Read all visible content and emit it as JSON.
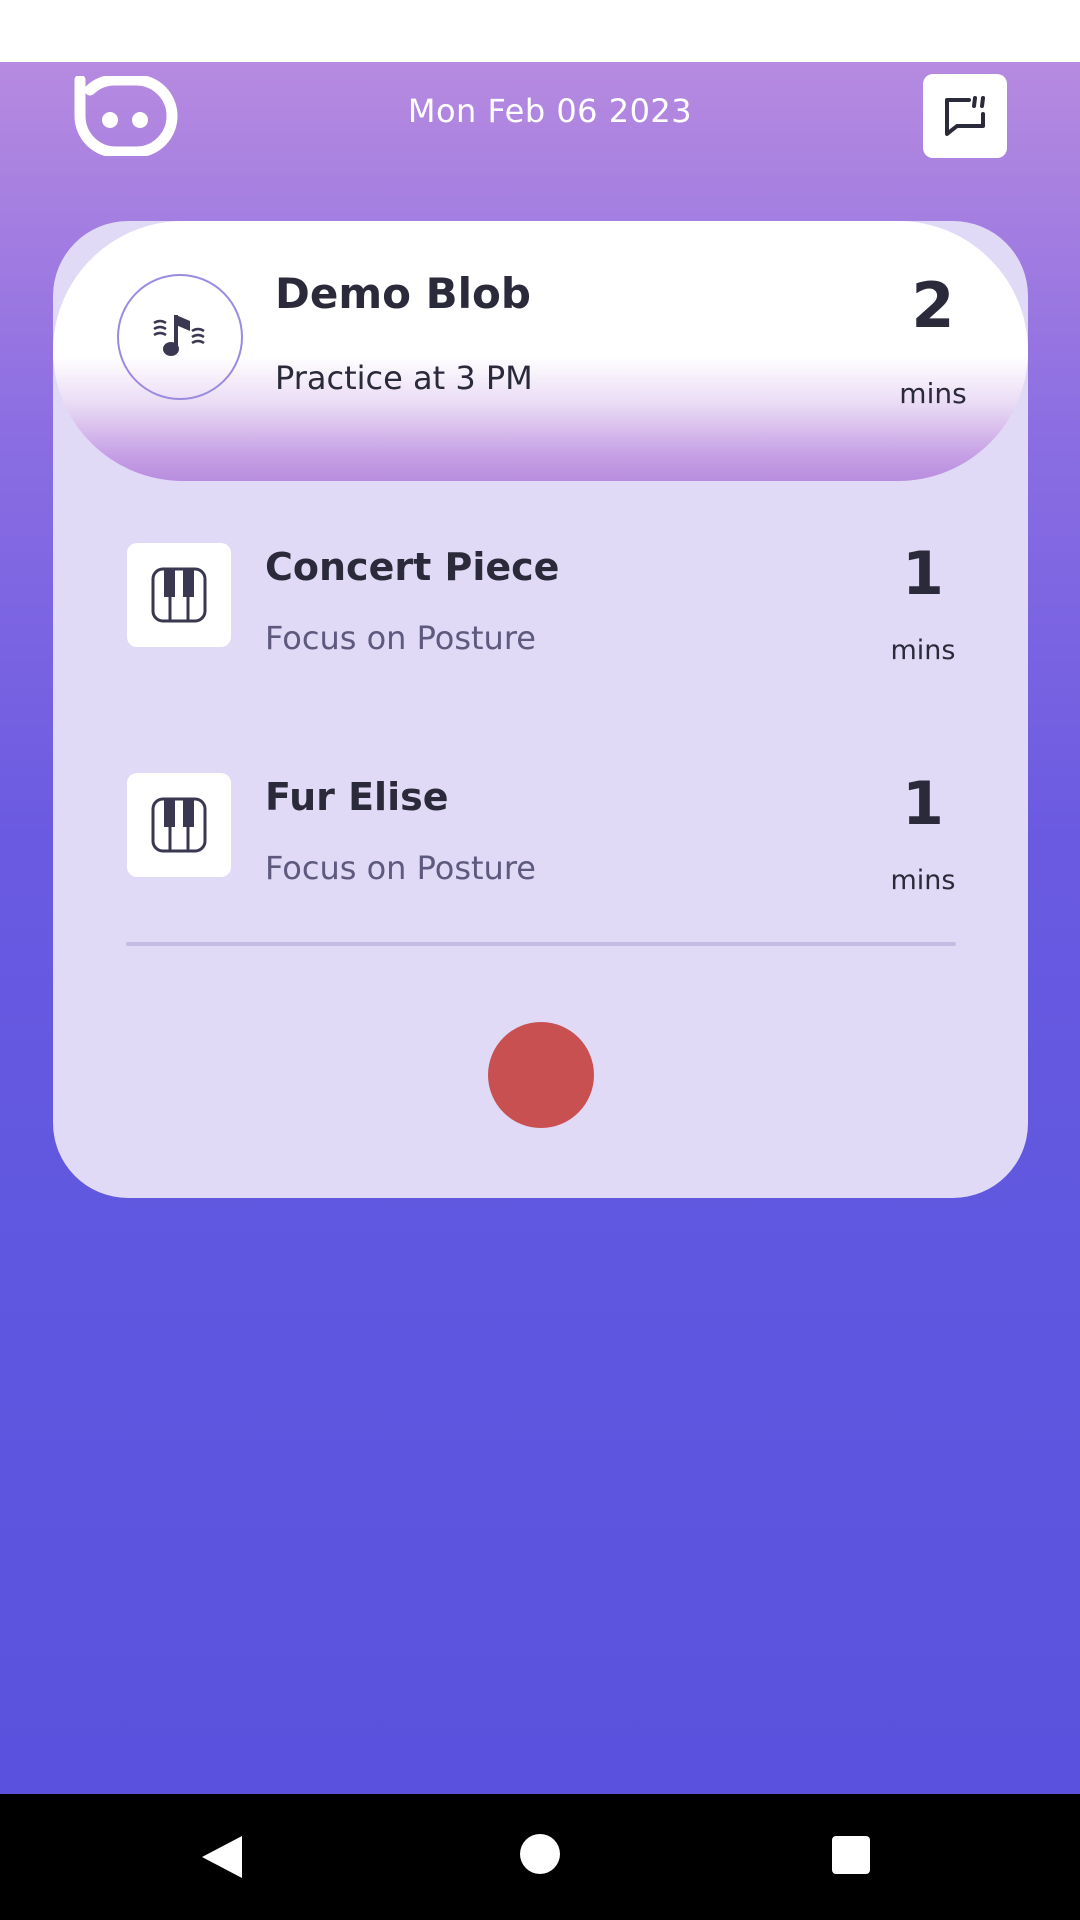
{
  "header": {
    "date": "Mon Feb 06 2023",
    "logo_icon": "blob-logo-icon",
    "feedback_icon": "feedback-chat-icon"
  },
  "session": {
    "title": "Demo Blob",
    "subtitle": "Practice at 3 PM",
    "duration": "2",
    "unit": "mins",
    "icon": "music-note-icon"
  },
  "pieces": [
    {
      "title": "Concert Piece",
      "focus": "Focus on Posture",
      "duration": "1",
      "unit": "mins",
      "icon": "piano-keys-icon"
    },
    {
      "title": "Fur Elise",
      "focus": "Focus on Posture",
      "duration": "1",
      "unit": "mins",
      "icon": "piano-keys-icon"
    }
  ],
  "controls": {
    "record_icon": "record-icon"
  },
  "colors": {
    "gradient_top": "#b68ae0",
    "gradient_bottom": "#5a52de",
    "card_bg": "#e0daf7",
    "record": "#c95050",
    "text": "#2b2a3a"
  }
}
